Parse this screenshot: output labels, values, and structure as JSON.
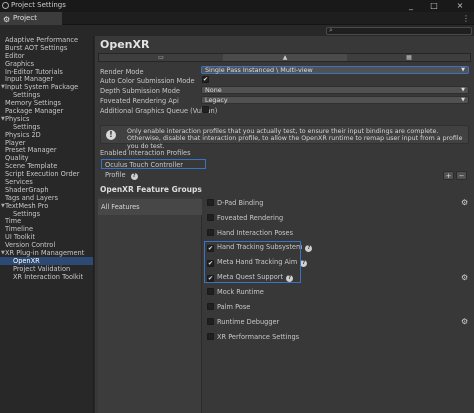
{
  "window": {
    "title": "Project Settings",
    "minimize": "_",
    "maximize": "□",
    "close": "×"
  },
  "tab": {
    "label": "Project Settings",
    "menu": "⋮"
  },
  "search": {
    "placeholder": ""
  },
  "sidebar": {
    "items": [
      {
        "label": "Adaptive Performance",
        "indent": 0,
        "arrow": ""
      },
      {
        "label": "Burst AOT Settings",
        "indent": 0,
        "arrow": ""
      },
      {
        "label": "Editor",
        "indent": 0,
        "arrow": ""
      },
      {
        "label": "Graphics",
        "indent": 0,
        "arrow": ""
      },
      {
        "label": "In-Editor Tutorials",
        "indent": 0,
        "arrow": ""
      },
      {
        "label": "Input Manager",
        "indent": 0,
        "arrow": ""
      },
      {
        "label": "Input System Package",
        "indent": 0,
        "arrow": "▼"
      },
      {
        "label": "Settings",
        "indent": 1,
        "arrow": ""
      },
      {
        "label": "Memory Settings",
        "indent": 0,
        "arrow": ""
      },
      {
        "label": "Package Manager",
        "indent": 0,
        "arrow": ""
      },
      {
        "label": "Physics",
        "indent": 0,
        "arrow": "▼"
      },
      {
        "label": "Settings",
        "indent": 1,
        "arrow": ""
      },
      {
        "label": "Physics 2D",
        "indent": 0,
        "arrow": ""
      },
      {
        "label": "Player",
        "indent": 0,
        "arrow": ""
      },
      {
        "label": "Preset Manager",
        "indent": 0,
        "arrow": ""
      },
      {
        "label": "Quality",
        "indent": 0,
        "arrow": ""
      },
      {
        "label": "Scene Template",
        "indent": 0,
        "arrow": ""
      },
      {
        "label": "Script Execution Order",
        "indent": 0,
        "arrow": ""
      },
      {
        "label": "Services",
        "indent": 0,
        "arrow": ""
      },
      {
        "label": "ShaderGraph",
        "indent": 0,
        "arrow": ""
      },
      {
        "label": "Tags and Layers",
        "indent": 0,
        "arrow": ""
      },
      {
        "label": "TextMesh Pro",
        "indent": 0,
        "arrow": "▼"
      },
      {
        "label": "Settings",
        "indent": 1,
        "arrow": ""
      },
      {
        "label": "Time",
        "indent": 0,
        "arrow": ""
      },
      {
        "label": "Timeline",
        "indent": 0,
        "arrow": ""
      },
      {
        "label": "UI Toolkit",
        "indent": 0,
        "arrow": ""
      },
      {
        "label": "Version Control",
        "indent": 0,
        "arrow": ""
      },
      {
        "label": "XR Plug-in Management",
        "indent": 0,
        "arrow": "▼"
      },
      {
        "label": "OpenXR",
        "indent": 1,
        "arrow": "",
        "selected": true
      },
      {
        "label": "Project Validation",
        "indent": 1,
        "arrow": ""
      },
      {
        "label": "XR Interaction Toolkit",
        "indent": 1,
        "arrow": ""
      }
    ]
  },
  "main": {
    "title": "OpenXR",
    "platform_tabs": [
      {
        "icon": "desktop-icon",
        "glyph": "▭",
        "active": false
      },
      {
        "icon": "android-icon",
        "glyph": "▲",
        "active": true
      },
      {
        "icon": "universal-windows-icon",
        "glyph": "▦",
        "active": false
      }
    ],
    "properties": {
      "render_mode": {
        "label": "Render Mode",
        "value": "Single Pass Instanced \\ Multi-view"
      },
      "auto_color_submission": {
        "label": "Auto Color Submission Mode",
        "checked": true
      },
      "depth_submission": {
        "label": "Depth Submission Mode",
        "value": "None"
      },
      "foveated_api": {
        "label": "Foveated Rendering Api",
        "value": "Legacy"
      },
      "graphics_queue": {
        "label": "Additional Graphics Queue (Vulkan)",
        "checked": false
      }
    },
    "help_message": "Only enable interaction profiles that you actually test, to ensure their input bindings are complete. Otherwise, disable that interaction profile, to allow the OpenXR runtime to remap user input from a profile you do test.",
    "enabled_profiles": {
      "label": "Enabled Interaction Profiles",
      "items": [
        "Oculus Touch Controller Profile"
      ],
      "add": "+",
      "remove": "−"
    },
    "feature_groups": {
      "title": "OpenXR Feature Groups",
      "groups": [
        "All Features"
      ],
      "features": [
        {
          "label": "D-Pad Binding",
          "checked": false,
          "help": false,
          "gear": true
        },
        {
          "label": "Foveated Rendering",
          "checked": false,
          "help": false,
          "gear": false
        },
        {
          "label": "Hand Interaction Poses",
          "checked": false,
          "help": false,
          "gear": false
        },
        {
          "label": "Hand Tracking Subsystem",
          "checked": true,
          "help": true,
          "gear": false
        },
        {
          "label": "Meta Hand Tracking Aim",
          "checked": true,
          "help": true,
          "gear": false
        },
        {
          "label": "Meta Quest Support",
          "checked": true,
          "help": true,
          "gear": true
        },
        {
          "label": "Mock Runtime",
          "checked": false,
          "help": false,
          "gear": false
        },
        {
          "label": "Palm Pose",
          "checked": false,
          "help": false,
          "gear": false
        },
        {
          "label": "Runtime Debugger",
          "checked": false,
          "help": false,
          "gear": true
        },
        {
          "label": "XR Performance Settings",
          "checked": false,
          "help": false,
          "gear": false
        }
      ]
    }
  },
  "colors": {
    "highlight": "#3a72c4",
    "selection": "#2d4a74",
    "panel": "#383838"
  }
}
